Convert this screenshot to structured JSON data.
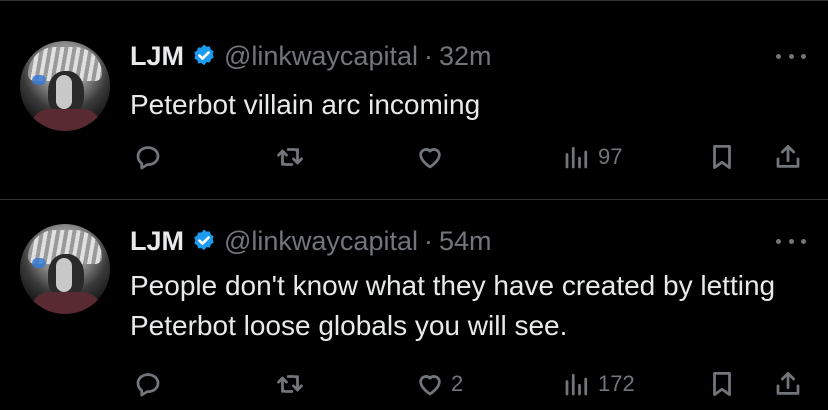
{
  "tweets": [
    {
      "author_name": "LJM",
      "handle": "@linkwaycapital",
      "separator": "·",
      "time": "32m",
      "text": "Peterbot villain arc incoming",
      "reply_count": "",
      "retweet_count": "",
      "like_count": "",
      "view_count": "97"
    },
    {
      "author_name": "LJM",
      "handle": "@linkwaycapital",
      "separator": "·",
      "time": "54m",
      "text": "People don't know what they have created by letting Peterbot loose globals you will see.",
      "reply_count": "",
      "retweet_count": "",
      "like_count": "2",
      "view_count": "172"
    }
  ],
  "icons": {
    "verified": "verified-badge-icon",
    "more": "more-options-icon",
    "reply": "reply-icon",
    "retweet": "retweet-icon",
    "like": "heart-icon",
    "views": "views-chart-icon",
    "bookmark": "bookmark-icon",
    "share": "share-icon"
  },
  "colors": {
    "background": "#000000",
    "text_primary": "#e7e9ea",
    "text_secondary": "#71767b",
    "verified_blue": "#1d9bf0",
    "divider": "#2f3336"
  }
}
